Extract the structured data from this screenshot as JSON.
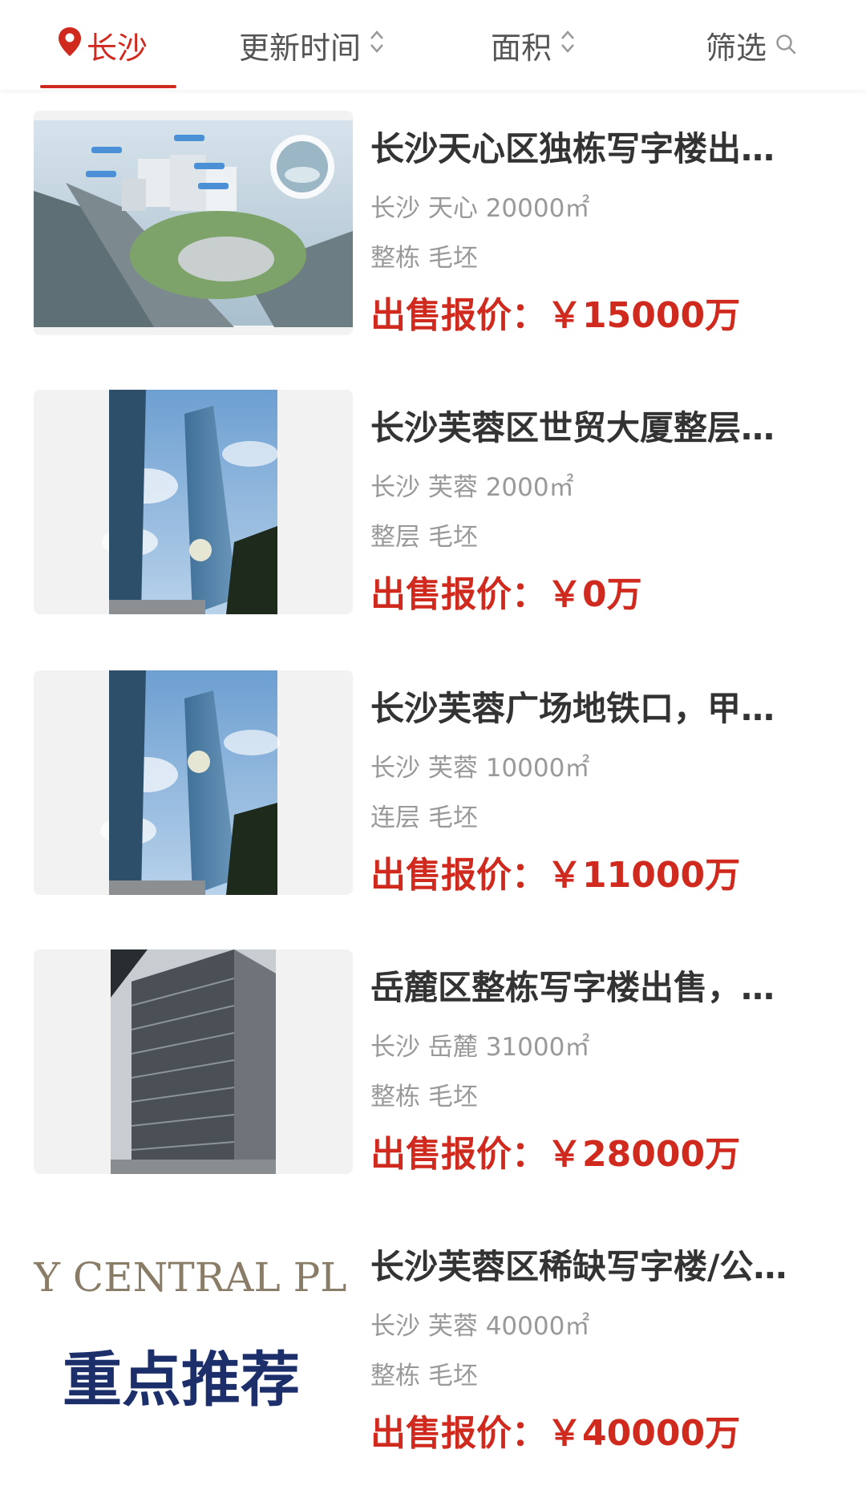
{
  "topbar": {
    "city": "长沙",
    "sort_time": "更新时间",
    "sort_area": "面积",
    "filter": "筛选"
  },
  "colors": {
    "accent": "#d0291e",
    "title": "#333333",
    "meta": "#999999"
  },
  "listings": [
    {
      "title": "长沙天心区独栋写字楼出…",
      "meta": "长沙 天心 20000㎡",
      "tags": "整栋 毛坯",
      "price_label": "出售报价：",
      "price_value": "￥15000万",
      "image_icon": "aerial-complex-photo"
    },
    {
      "title": "长沙芙蓉区世贸大厦整层…",
      "meta": "长沙 芙蓉 2000㎡",
      "tags": "整层 毛坯",
      "price_label": "出售报价：",
      "price_value": "￥0万",
      "image_icon": "tower-photo"
    },
    {
      "title": "长沙芙蓉广场地铁口，甲…",
      "meta": "长沙 芙蓉 10000㎡",
      "tags": "连层 毛坯",
      "price_label": "出售报价：",
      "price_value": "￥11000万",
      "image_icon": "tower-photo"
    },
    {
      "title": "岳麓区整栋写字楼出售，…",
      "meta": "长沙 岳麓 31000㎡",
      "tags": "整栋 毛坯",
      "price_label": "出售报价：",
      "price_value": "￥28000万",
      "image_icon": "office-building-photo"
    },
    {
      "title": "长沙芙蓉区稀缺写字楼/公…",
      "meta": "长沙 芙蓉 40000㎡",
      "tags": "整栋 毛坯",
      "price_label": "出售报价：",
      "price_value": "￥40000万",
      "image_icon": "promo-banner-image",
      "image_text_top": "Y CENTRAL PL",
      "image_text_main": "重点推荐"
    }
  ]
}
